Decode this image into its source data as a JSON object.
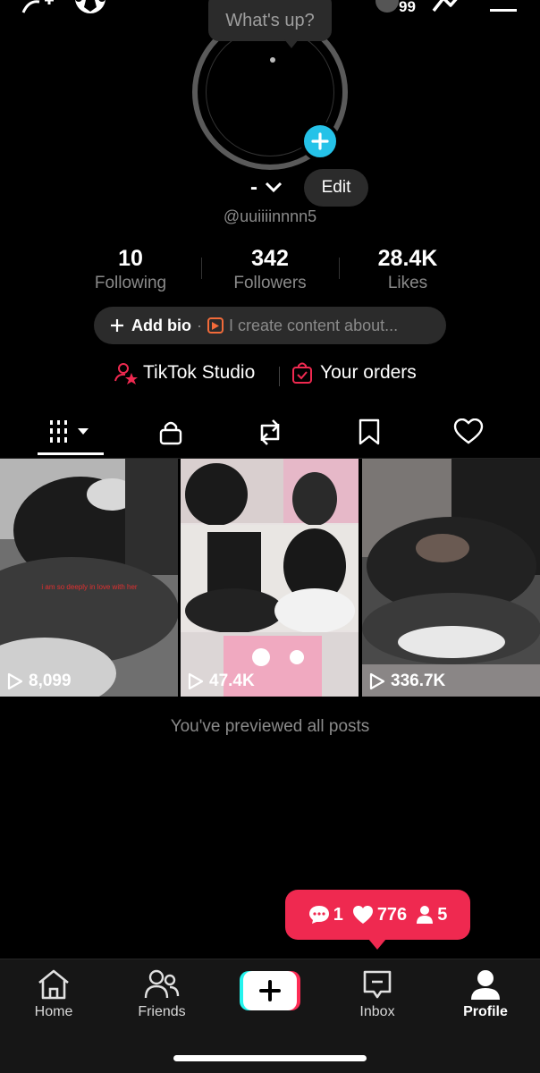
{
  "top_bar": {
    "add_friend_icon": "add-user-icon",
    "soccer_icon": "soccer-ball-icon",
    "avatar_badge": "99",
    "trending_icon": "trending-icon",
    "menu_icon": "hamburger-menu-icon"
  },
  "profile": {
    "status_bubble": "What's up?",
    "name": "-",
    "edit_label": "Edit",
    "handle": "@uuiiiinnnn5",
    "stats": [
      {
        "value": "10",
        "label": "Following"
      },
      {
        "value": "342",
        "label": "Followers"
      },
      {
        "value": "28.4K",
        "label": "Likes"
      }
    ],
    "bio": {
      "add_label": "Add bio",
      "separator": "·",
      "placeholder": "I create content about..."
    },
    "studio_label": "TikTok Studio",
    "orders_label": "Your orders",
    "accent_color": "#ef2950",
    "plus_color": "#25c2e8"
  },
  "tabs": [
    {
      "name": "videos",
      "icon": "grid-icon",
      "active": true
    },
    {
      "name": "private",
      "icon": "lock-icon"
    },
    {
      "name": "reposts",
      "icon": "repost-icon"
    },
    {
      "name": "favorites",
      "icon": "bookmark-icon"
    },
    {
      "name": "liked",
      "icon": "heart-icon"
    }
  ],
  "posts": [
    {
      "views": "8,099",
      "caption": "i am so deeply in love with her"
    },
    {
      "views": "47.4K"
    },
    {
      "views": "336.7K"
    }
  ],
  "end_message": "You've previewed all posts",
  "notifications": {
    "comments": "1",
    "likes": "776",
    "followers": "5"
  },
  "nav": {
    "items": [
      {
        "label": "Home",
        "icon": "home-icon"
      },
      {
        "label": "Friends",
        "icon": "friends-icon"
      },
      {
        "label": "",
        "icon": "create-plus-icon"
      },
      {
        "label": "Inbox",
        "icon": "inbox-icon"
      },
      {
        "label": "Profile",
        "icon": "profile-icon",
        "active": true
      }
    ]
  }
}
